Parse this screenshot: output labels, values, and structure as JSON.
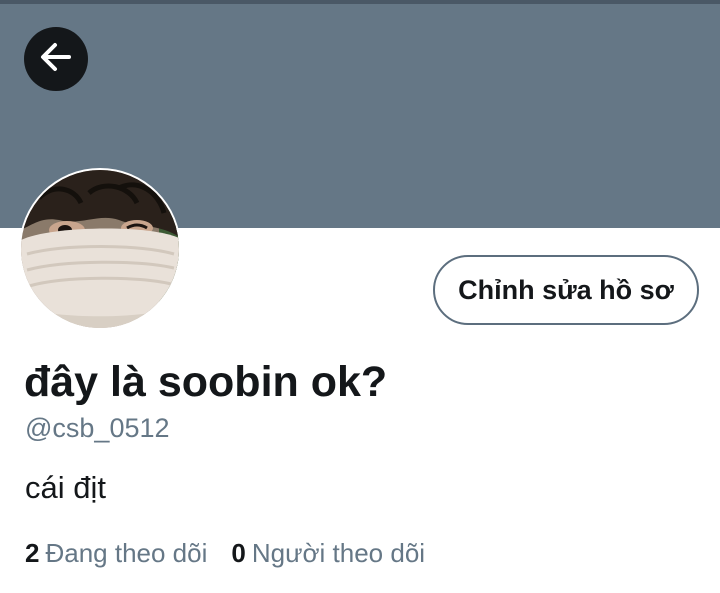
{
  "colors": {
    "banner": "#657786",
    "text_primary": "#14171a",
    "text_secondary": "#657786",
    "button_border": "#5c6e7e"
  },
  "header": {
    "back_icon": "arrow-left-icon"
  },
  "profile": {
    "edit_button_label": "Chỉnh sửa hồ sơ",
    "display_name": "đây là soobin ok?",
    "handle": "@csb_0512",
    "bio": "cái địt",
    "following_count": "2",
    "following_label": "Đang theo dõi",
    "followers_count": "0",
    "followers_label": "Người theo dõi"
  }
}
